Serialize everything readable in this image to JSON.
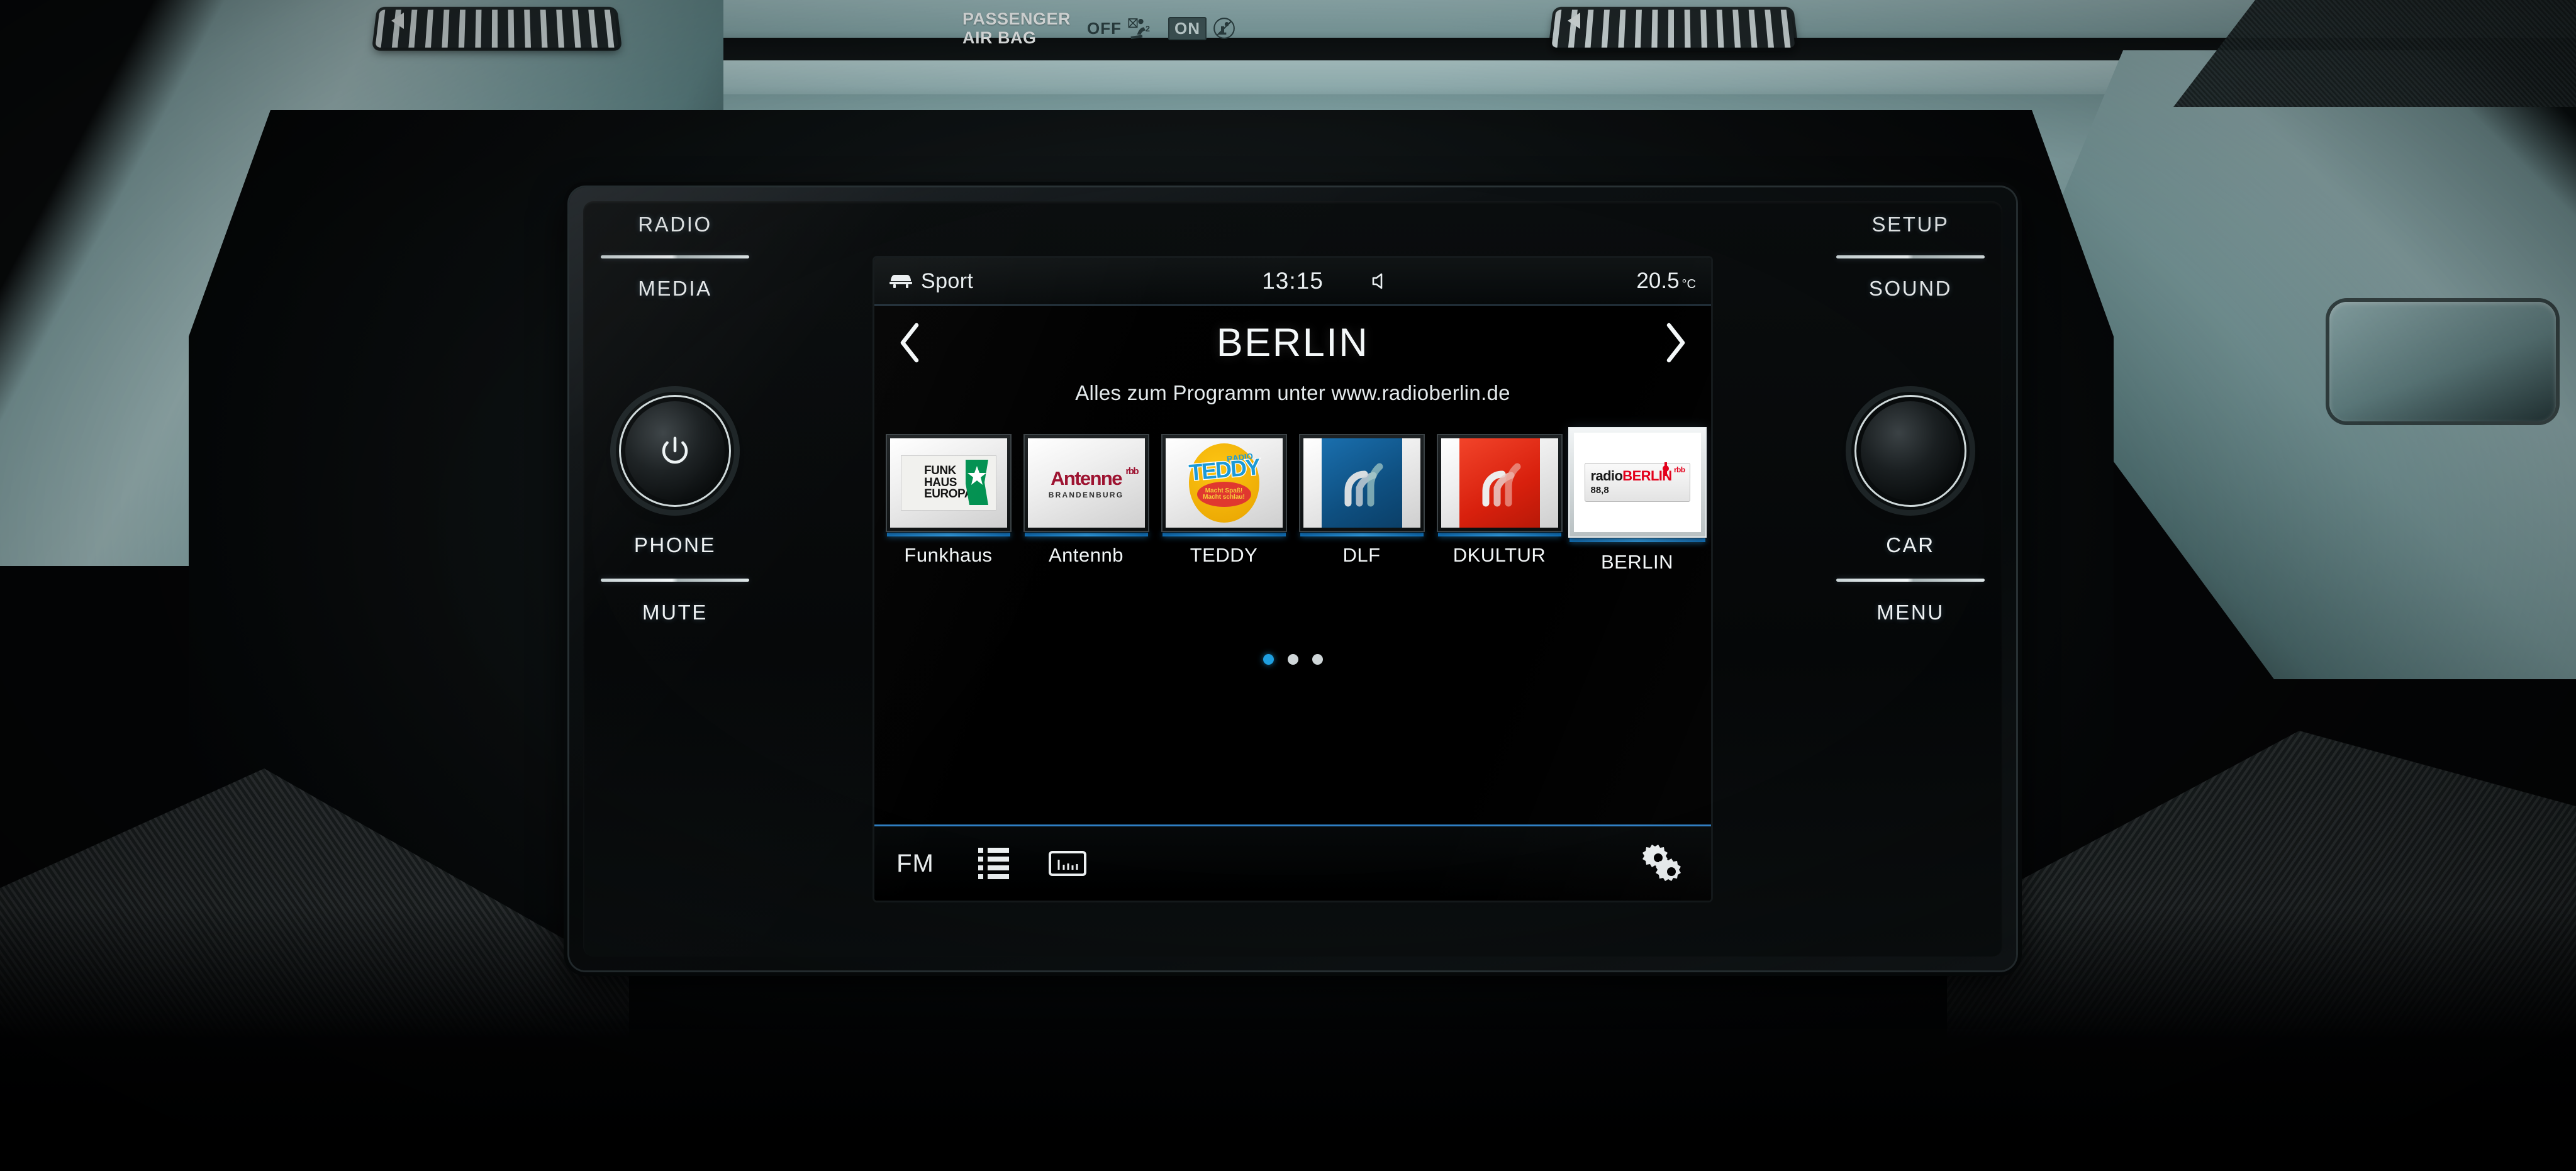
{
  "dashboard": {
    "airbag": {
      "title_line1": "PASSENGER",
      "title_line2": "AIR BAG",
      "off_label": "OFF",
      "on_label": "ON",
      "off_icon": "airbag-off-child-seat-icon",
      "on_icon": "airbag-on-no-child-seat-icon"
    },
    "vent_left_icon": "air-vent-left",
    "vent_right_icon": "air-vent-right"
  },
  "hardware": {
    "left": {
      "radio": "RADIO",
      "media": "MEDIA",
      "phone": "PHONE",
      "mute": "MUTE",
      "knob_icon": "power-volume-knob"
    },
    "right": {
      "setup": "SETUP",
      "sound": "SOUND",
      "car": "CAR",
      "menu": "MENU",
      "knob_icon": "tune-knob"
    }
  },
  "screen": {
    "statusbar": {
      "mode_icon": "car-front-icon",
      "mode": "Sport",
      "time": "13:15",
      "speaker_icon": "speaker-icon",
      "temperature": "20.5",
      "temperature_unit": "°C"
    },
    "header": {
      "prev_icon": "chevron-left-icon",
      "next_icon": "chevron-right-icon",
      "station_title": "BERLIN",
      "subtitle": "Alles zum Programm unter www.radioberlin.de"
    },
    "presets": [
      {
        "name": "Funkhaus",
        "selected": false,
        "logo_kind": "funkhaus",
        "logo_text": "FUNK HAUS EUROPA",
        "logo_line1": "FUNK",
        "logo_line2": "HAUS",
        "logo_line3": "EUROPA",
        "accent": "#009150"
      },
      {
        "name": "Antennb",
        "selected": false,
        "logo_kind": "antenne",
        "logo_text": "Antenne",
        "logo_super": "rbb",
        "logo_sub": "BRANDENBURG",
        "accent": "#9d1230"
      },
      {
        "name": "TEDDY",
        "selected": false,
        "logo_kind": "teddy",
        "logo_small": "RADIO",
        "logo_text": "TEDDY",
        "logo_tag1": "Macht Spaß!",
        "logo_tag2": "Macht schlau!",
        "accent": "#e8a300"
      },
      {
        "name": "DLF",
        "selected": false,
        "logo_kind": "wave-blue",
        "accent": "#1a6fae"
      },
      {
        "name": "DKULTUR",
        "selected": false,
        "logo_kind": "wave-red",
        "accent": "#e0301a"
      },
      {
        "name": "BERLIN",
        "selected": true,
        "logo_kind": "radioberlin",
        "logo_prefix": "radio",
        "logo_main": "BERLIN",
        "logo_super": "rbb",
        "logo_freq": "88,8",
        "accent": "#e3001b"
      }
    ],
    "pagination": {
      "pages": 3,
      "active": 1
    },
    "toolbar": {
      "band_label": "FM",
      "list_icon": "station-list-icon",
      "scale_icon": "frequency-scale-icon",
      "settings_icon": "settings-gears-icon"
    }
  },
  "colors": {
    "accent_blue": "#2f9fe8",
    "toolbar_rule": "#2f7fc4",
    "screen_bg": "#000000",
    "text": "#f2f6f7",
    "dash_teal": "#7fa2a4"
  }
}
